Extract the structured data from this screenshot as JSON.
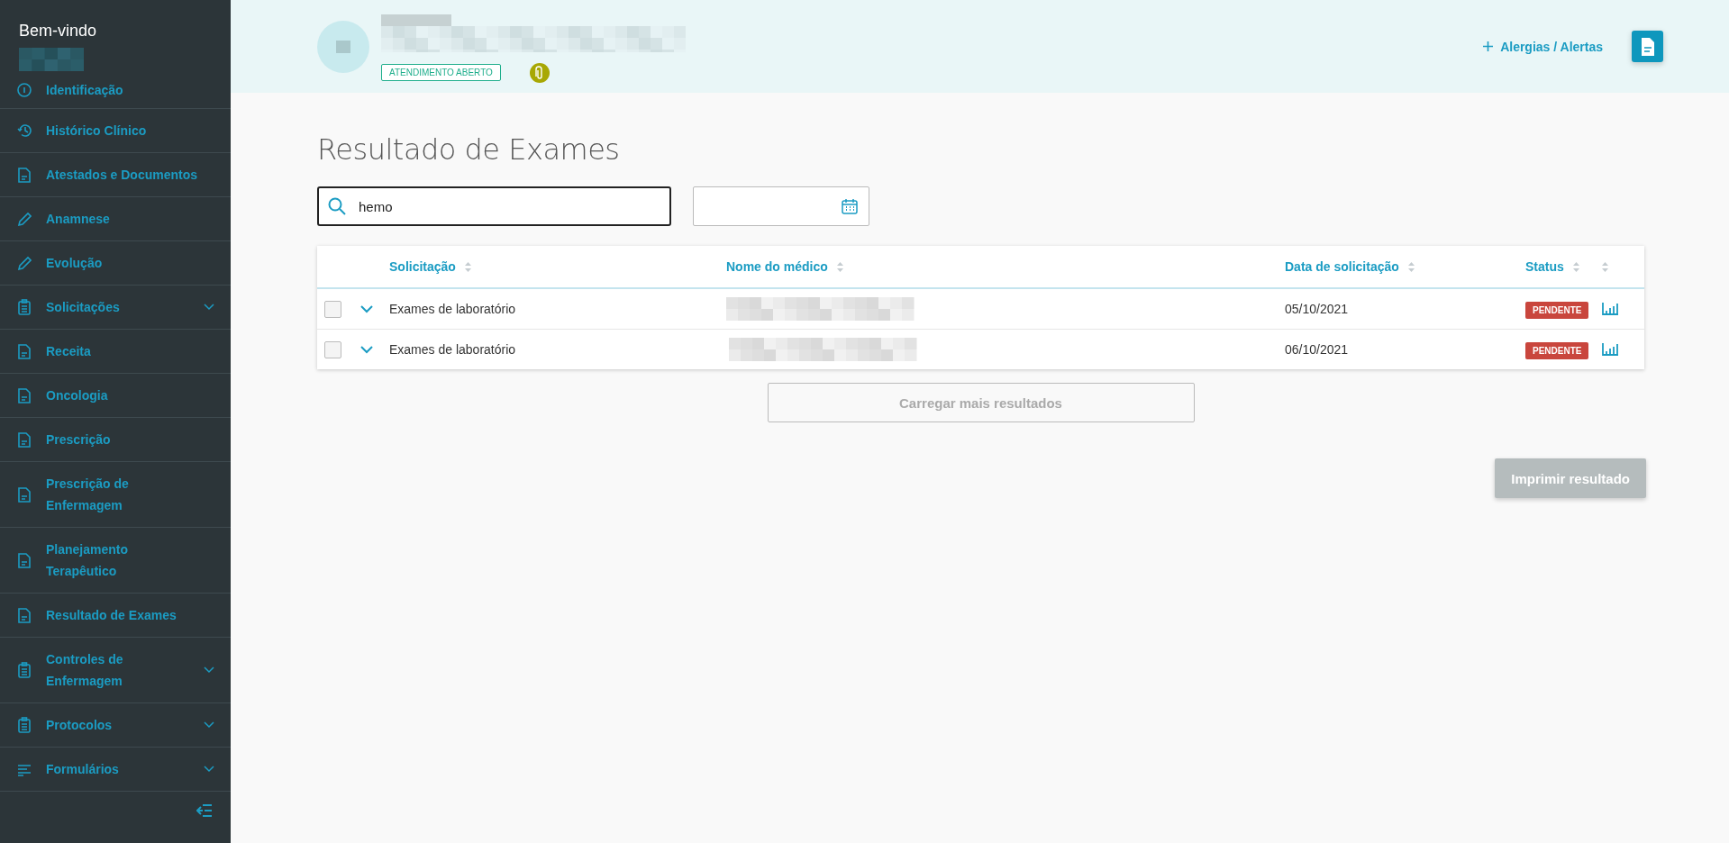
{
  "sidebar": {
    "greeting": "Bem-vindo",
    "items": [
      {
        "label": "Identificação",
        "kind": "info",
        "expandable": false
      },
      {
        "label": "Histórico Clínico",
        "kind": "history",
        "expandable": false
      },
      {
        "label": "Atestados e Documentos",
        "kind": "document",
        "expandable": false
      },
      {
        "label": "Anamnese",
        "kind": "pencil",
        "expandable": false
      },
      {
        "label": "Evolução",
        "kind": "pencil",
        "expandable": false
      },
      {
        "label": "Solicitações",
        "kind": "clipboard",
        "expandable": true
      },
      {
        "label": "Receita",
        "kind": "document",
        "expandable": false
      },
      {
        "label": "Oncologia",
        "kind": "document",
        "expandable": false
      },
      {
        "label": "Prescrição",
        "kind": "document",
        "expandable": false
      },
      {
        "label": "Prescrição de Enfermagem",
        "kind": "document",
        "expandable": false
      },
      {
        "label": "Planejamento Terapêutico",
        "kind": "document",
        "expandable": false
      },
      {
        "label": "Resultado de Exames",
        "kind": "document",
        "expandable": false
      },
      {
        "label": "Controles de Enfermagem",
        "kind": "clipboard",
        "expandable": true
      },
      {
        "label": "Protocolos",
        "kind": "clipboard",
        "expandable": true
      },
      {
        "label": "Formulários",
        "kind": "lines",
        "expandable": true
      }
    ]
  },
  "header": {
    "badge": "ATENDIMENTO ABERTO",
    "alerts_link": "Alergias / Alertas"
  },
  "page": {
    "title": "Resultado de Exames",
    "search": {
      "value": "hemo"
    }
  },
  "table": {
    "columns": [
      {
        "label": "Solicitação",
        "sortable": true
      },
      {
        "label": "Nome do médico",
        "sortable": true
      },
      {
        "label": "Data de solicitação",
        "sortable": true
      },
      {
        "label": "Status",
        "sortable": true
      },
      {
        "sortable": true
      }
    ],
    "rows": [
      {
        "checked": false,
        "expanded": false,
        "request": "Exames de laboratório",
        "date": "05/10/2021",
        "status": {
          "label": "PENDENTE",
          "color": "#c9463d"
        }
      },
      {
        "checked": false,
        "expanded": false,
        "request": "Exames de laboratório",
        "date": "06/10/2021",
        "status": {
          "label": "PENDENTE",
          "color": "#c9463d"
        }
      }
    ]
  },
  "buttons": {
    "load_more": "Carregar mais resultados",
    "print": "Imprimir resultado"
  }
}
